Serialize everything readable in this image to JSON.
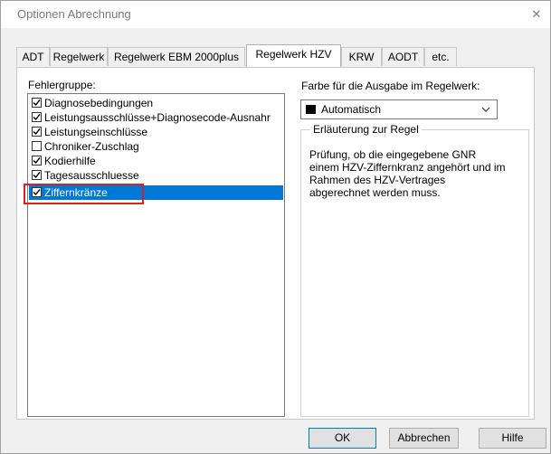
{
  "window": {
    "title": "Optionen Abrechnung",
    "close_glyph": "✕"
  },
  "tabs": [
    {
      "label": "ADT",
      "active": false
    },
    {
      "label": "Regelwerk",
      "active": false
    },
    {
      "label": "Regelwerk EBM 2000plus",
      "active": false
    },
    {
      "label": "Regelwerk HZV",
      "active": true
    },
    {
      "label": "KRW",
      "active": false
    },
    {
      "label": "AODT",
      "active": false
    },
    {
      "label": "etc.",
      "active": false
    }
  ],
  "left": {
    "label": "Fehlergruppe:",
    "items": [
      {
        "label": "Diagnosebedingungen",
        "checked": true,
        "selected": false
      },
      {
        "label": "Leistungsausschlüsse+Diagnosecode-Ausnahr",
        "checked": true,
        "selected": false
      },
      {
        "label": "Leistungseinschlüsse",
        "checked": true,
        "selected": false
      },
      {
        "label": "Chroniker-Zuschlag",
        "checked": false,
        "selected": false
      },
      {
        "label": "Kodierhilfe",
        "checked": true,
        "selected": false
      },
      {
        "label": "Tagesausschluesse",
        "checked": true,
        "selected": false
      },
      {
        "label": "Ziffernkränze",
        "checked": true,
        "selected": true
      }
    ]
  },
  "right": {
    "color_label": "Farbe für die Ausgabe im Regelwerk:",
    "color_value": "Automatisch",
    "swatch_color": "#000000",
    "group_title": "Erläuterung zur Regel",
    "description_lines": [
      "Prüfung, ob die eingegebene GNR",
      "einem HZV-Ziffernkranz angehört und im",
      "Rahmen des HZV-Vertrages",
      "abgerechnet werden muss."
    ]
  },
  "buttons": {
    "ok": "OK",
    "cancel": "Abbrechen",
    "help": "Hilfe"
  },
  "colors": {
    "selection": "#0078d7",
    "highlight_box": "#e02020"
  }
}
